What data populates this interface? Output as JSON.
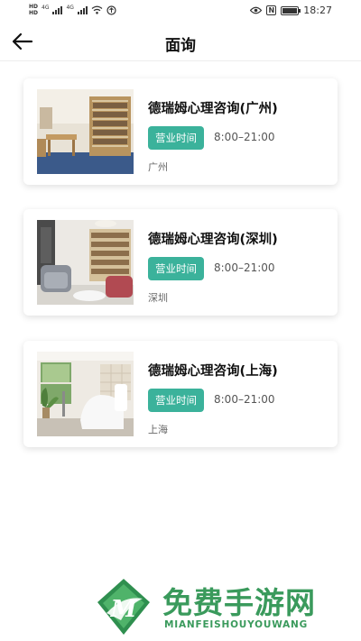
{
  "status_bar": {
    "hd1": "HD",
    "hd2": "HD",
    "net1": "4G",
    "net2": "4G",
    "time": "18:27",
    "nfc": "N",
    "battery_level": 0.85
  },
  "header": {
    "title": "面询"
  },
  "cards": [
    {
      "name": "德瑞姆心理咨询(广州)",
      "hours_label": "营业时间",
      "hours": "8:00–21:00",
      "city": "广州"
    },
    {
      "name": "德瑞姆心理咨询(深圳)",
      "hours_label": "营业时间",
      "hours": "8:00–21:00",
      "city": "深圳"
    },
    {
      "name": "德瑞姆心理咨询(上海)",
      "hours_label": "营业时间",
      "hours": "8:00–21:00",
      "city": "上海"
    }
  ],
  "watermark": {
    "title": "免费手游网",
    "subtitle": "MIANFEISHOUYOUWANG",
    "logo_letter": "M"
  },
  "colors": {
    "accent": "#3bb29b",
    "watermark": "#3a9a5c"
  }
}
